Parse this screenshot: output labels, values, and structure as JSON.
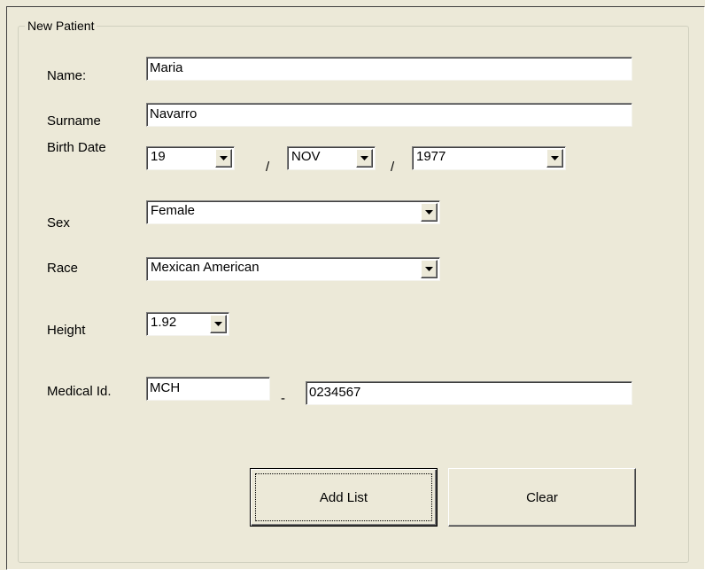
{
  "group": {
    "title": "New Patient"
  },
  "form": {
    "name": {
      "label": "Name:",
      "value": "Maria"
    },
    "surname": {
      "label": "Surname",
      "value": "Navarro"
    },
    "birth_date": {
      "label": "Birth Date",
      "day": "19",
      "month": "NOV",
      "year": "1977",
      "separator": "/"
    },
    "sex": {
      "label": "Sex",
      "value": "Female"
    },
    "race": {
      "label": "Race",
      "value": "Mexican American"
    },
    "height": {
      "label": "Height",
      "value": "1.92"
    },
    "medical_id": {
      "label": "Medical Id.",
      "prefix": "MCH",
      "separator": "-",
      "number": "0234567"
    }
  },
  "buttons": {
    "add_list": "Add List",
    "clear": "Clear"
  },
  "icons": {
    "dropdown": "chevron-down-icon"
  }
}
